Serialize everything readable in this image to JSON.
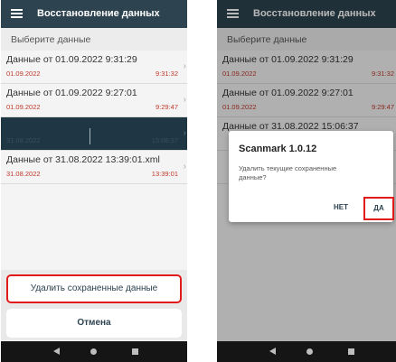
{
  "app": {
    "title": "Восстановление данных",
    "subheader": "Выберите данные"
  },
  "items": [
    {
      "name": "Данные от 01.09.2022 9:31:29",
      "date": "01.09.2022",
      "time": "9:31:32"
    },
    {
      "name": "Данные от 01.09.2022 9:27:01",
      "date": "01.09.2022",
      "time": "9:29:47"
    },
    {
      "name": "Данные от 31.08.2022 15:06:37",
      "date": "31.08.2022",
      "time": "15:06:37"
    },
    {
      "name": "Данные от 31.08.2022 13:39:01.xml",
      "date": "31.08.2022",
      "time": "13:39:01"
    }
  ],
  "sheet": {
    "delete_label": "Удалить сохраненные данные",
    "cancel_label": "Отмена"
  },
  "dialog": {
    "title": "Scanmark 1.0.12",
    "message": "Удалить текущие сохраненные данные?",
    "no_label": "НЕТ",
    "yes_label": "ДА"
  },
  "colors": {
    "appbar": "#2d4350",
    "selected_row": "#1f3644",
    "accent_red": "#c0392b",
    "highlight": "#e31a1a"
  }
}
